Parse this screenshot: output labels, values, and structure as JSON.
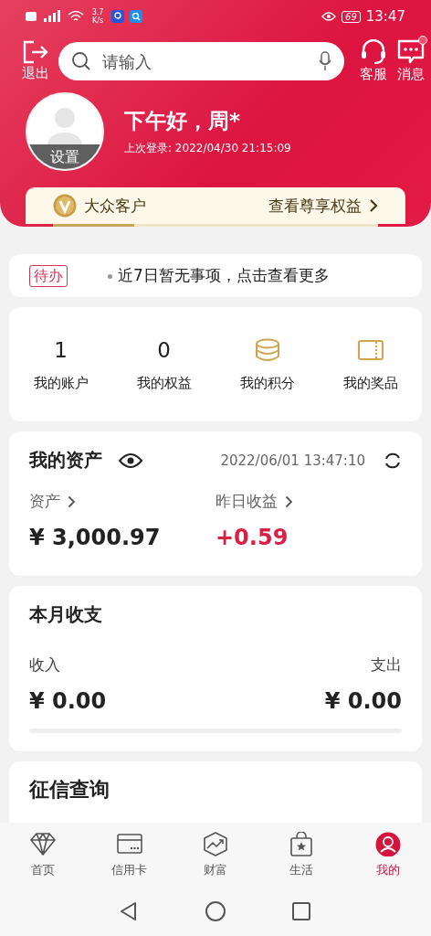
{
  "status_bar": {
    "network_speed": "3.7 K/s",
    "battery": "69",
    "time": "13:47"
  },
  "header": {
    "logout_label": "退出",
    "search": {
      "placeholder": "请输入"
    },
    "service_label": "客服",
    "message_label": "消息",
    "message_unread": true
  },
  "profile": {
    "avatar_label": "设置",
    "greeting": "下午好，周*",
    "last_login": "上次登录: 2022/04/30 21:15:09"
  },
  "membership": {
    "level_name": "大众客户",
    "link": "查看尊享权益",
    "level": 0.25
  },
  "todo": {
    "badge": "待办",
    "message": "近7日暂无事项，点击查看更多"
  },
  "stats": [
    {
      "kind": "count",
      "value": "1",
      "label": "我的账户"
    },
    {
      "kind": "count",
      "value": "0",
      "label": "我的权益"
    },
    {
      "kind": "coins",
      "label": "我的积分"
    },
    {
      "kind": "ticket",
      "label": "我的奖品"
    }
  ],
  "assets": {
    "title": "我的资产",
    "updated": "2022/06/01 13:47:10",
    "columns": [
      {
        "label": "资产",
        "value": "¥ 3,000.97",
        "positive": false
      },
      {
        "label": "昨日收益",
        "value": "+0.59",
        "positive": true
      }
    ]
  },
  "monthly": {
    "title": "本月收支",
    "income_label": "收入",
    "expense_label": "支出",
    "income": "¥ 0.00",
    "expense": "¥ 0.00"
  },
  "credit": {
    "title": "征信查询"
  },
  "tabs": [
    {
      "kind": "diamond",
      "label": "首页",
      "selected": false
    },
    {
      "kind": "card",
      "label": "信用卡",
      "selected": false
    },
    {
      "kind": "chart",
      "label": "财富",
      "selected": false
    },
    {
      "kind": "bag",
      "label": "生活",
      "selected": false
    },
    {
      "kind": "person",
      "label": "我的",
      "selected": true
    }
  ]
}
